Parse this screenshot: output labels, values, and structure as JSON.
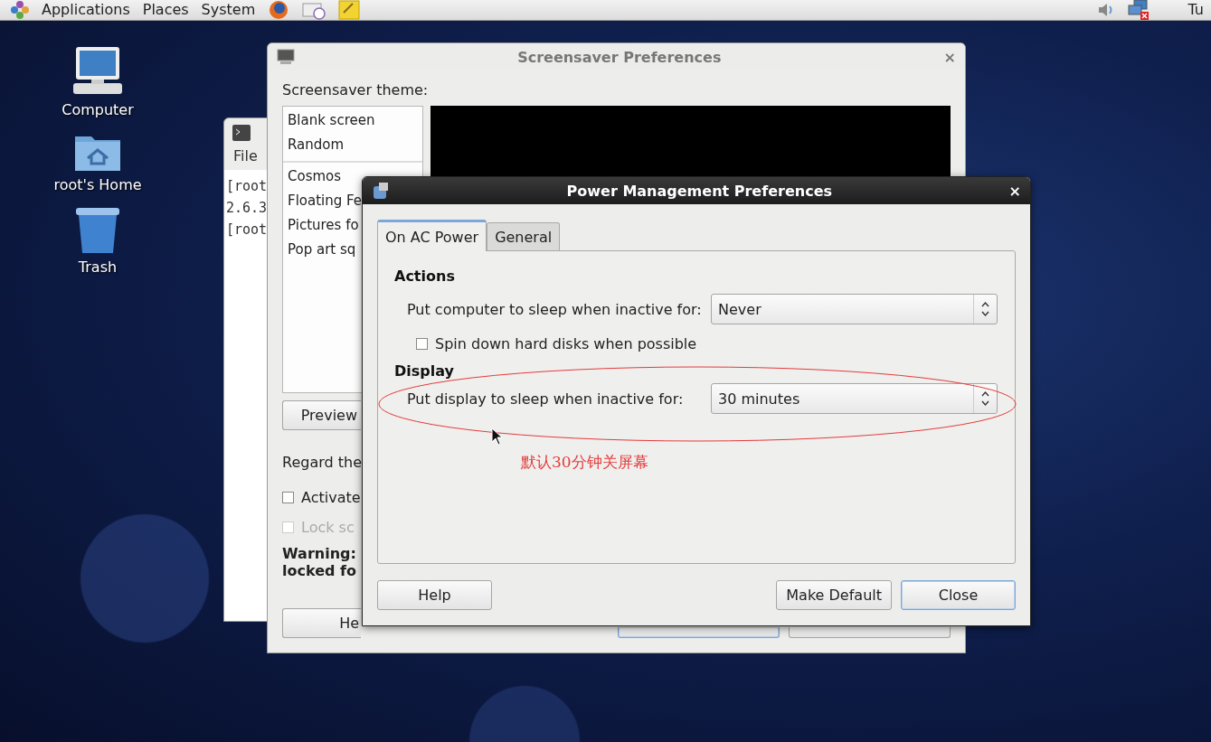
{
  "top_panel": {
    "menus": [
      "Applications",
      "Places",
      "System"
    ],
    "clock": "Tu"
  },
  "desktop_icons": [
    {
      "label": "Computer",
      "kind": "computer"
    },
    {
      "label": "root's Home",
      "kind": "home"
    },
    {
      "label": "Trash",
      "kind": "trash"
    }
  ],
  "terminal_window": {
    "menus": [
      "File"
    ],
    "lines": [
      "[root",
      "2.6.3",
      "[root"
    ]
  },
  "screensaver_window": {
    "title": "Screensaver Preferences",
    "close_button": "×",
    "theme_label": "Screensaver theme:",
    "theme_groups": [
      {
        "items": [
          "Blank screen",
          "Random"
        ]
      },
      {
        "items": [
          "Cosmos",
          "Floating Fe",
          "Pictures fo",
          "Pop art sq"
        ]
      }
    ],
    "preview_button": "Preview",
    "regard_text": "Regard the",
    "checkboxes": [
      {
        "label": "Activate",
        "checked": false,
        "disabled": false
      },
      {
        "label": "Lock sc",
        "checked": false,
        "disabled": true
      }
    ],
    "warning_lines": [
      "Warning:",
      "locked fo"
    ],
    "buttons": [
      {
        "label": "He",
        "default": false
      },
      {
        "default": true
      },
      {
        "default": false
      }
    ]
  },
  "power_window": {
    "title": "Power Management Preferences",
    "close_button": "×",
    "tabs": [
      {
        "label": "On AC Power",
        "selected": true
      },
      {
        "label": "General",
        "selected": false
      }
    ],
    "sections": [
      {
        "heading": "Actions",
        "rows": [
          {
            "kind": "combo",
            "label": "Put computer to sleep when inactive for:",
            "value": "Never"
          },
          {
            "kind": "checkbox",
            "label": "Spin down hard disks when possible",
            "checked": false
          }
        ]
      },
      {
        "heading": "Display",
        "rows": [
          {
            "kind": "combo",
            "label": "Put display to sleep when inactive for:",
            "value": "30 minutes"
          }
        ]
      }
    ],
    "buttons": [
      {
        "label": "Help",
        "default": false
      },
      {
        "label": "Make Default",
        "default": false
      },
      {
        "label": "Close",
        "default": true
      }
    ]
  },
  "annotation": {
    "text": "默认30分钟关屏幕"
  }
}
